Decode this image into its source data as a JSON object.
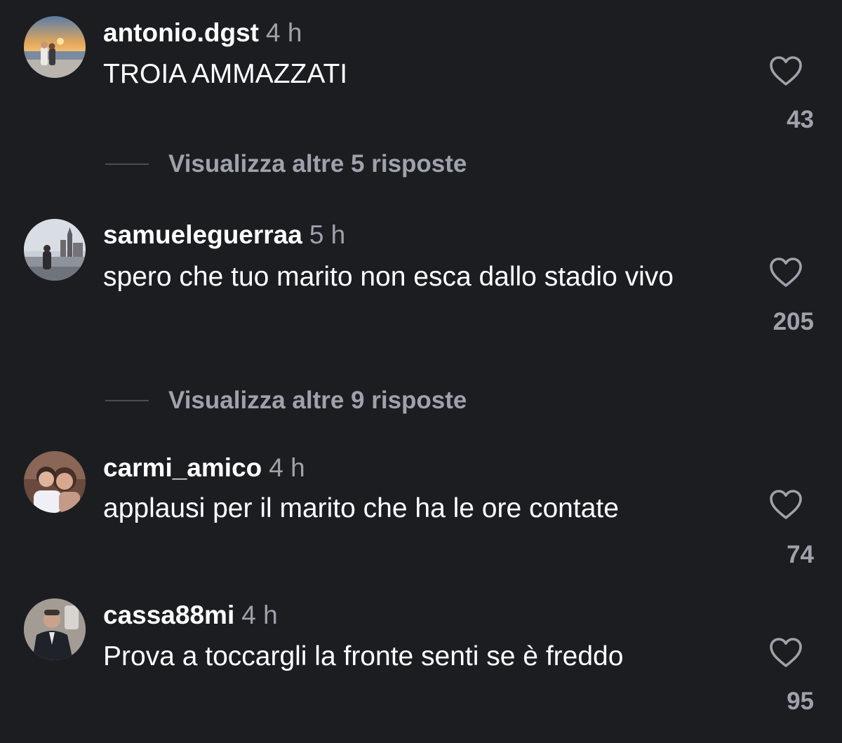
{
  "comments": [
    {
      "username": "antonio.dgst",
      "time": "4 h",
      "text": "TROIA AMMAZZATI",
      "likes": "43",
      "avatar": "sunset-harbor-photo"
    },
    {
      "username": "samueleguerraa",
      "time": "5 h",
      "text": "spero che tuo marito non esca dallo stadio vivo",
      "likes": "205",
      "avatar": "city-canal-photo"
    },
    {
      "username": "carmi_amico",
      "time": "4 h",
      "text": "applausi per il marito che ha le ore contate",
      "likes": "74",
      "avatar": "mother-child-photo"
    },
    {
      "username": "cassa88mi",
      "time": "4 h",
      "text": "Prova a toccargli la fronte senti se è freddo",
      "likes": "95",
      "avatar": "mirror-selfie-photo"
    }
  ],
  "replies": [
    {
      "label": "Visualizza altre 5 risposte"
    },
    {
      "label": "Visualizza altre 9 risposte"
    }
  ],
  "icons": {
    "like": "heart-outline-icon"
  },
  "colors": {
    "background": "#1c1d21",
    "primary_text": "#ffffff",
    "secondary_text": "#9ea2ab"
  }
}
